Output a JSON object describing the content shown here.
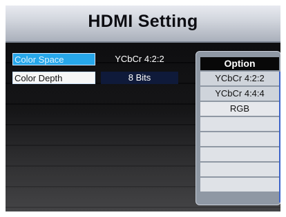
{
  "title": "HDMI Setting",
  "settings": [
    {
      "label": "Color Space",
      "value": "YCbCr 4:2:2",
      "focused": true
    },
    {
      "label": "Color Depth",
      "value": "8 Bits",
      "focused": false
    }
  ],
  "option_popup": {
    "header": "Option",
    "items": [
      "YCbCr 4:2:2",
      "YCbCr 4:4:4",
      "RGB"
    ],
    "selected": "YCbCr 4:2:2"
  },
  "colors": {
    "focus_label": "#27a7ea",
    "scrollbar": "#3b63c9"
  }
}
